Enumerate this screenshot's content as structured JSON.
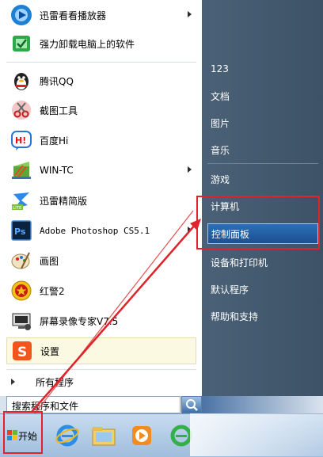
{
  "programs": [
    {
      "label": "迅雷看看播放器",
      "icon": "xunlei-kankan-icon",
      "submenu": true
    },
    {
      "label": "强力卸载电脑上的软件",
      "icon": "uninstall-icon",
      "submenu": false
    },
    {
      "label": "腾讯QQ",
      "icon": "qq-penguin-icon",
      "submenu": false
    },
    {
      "label": "截图工具",
      "icon": "snipping-tool-icon",
      "submenu": false
    },
    {
      "label": "百度Hi",
      "icon": "baidu-hi-icon",
      "submenu": false
    },
    {
      "label": "WIN-TC",
      "icon": "win-tc-icon",
      "submenu": true
    },
    {
      "label": "迅雷精简版",
      "icon": "xunlei-lite-icon",
      "submenu": false
    },
    {
      "label": "Adobe Photoshop CS5.1",
      "icon": "photoshop-icon",
      "submenu": true
    },
    {
      "label": "画图",
      "icon": "paint-icon",
      "submenu": false
    },
    {
      "label": "红警2",
      "icon": "red-alert-icon",
      "submenu": false
    },
    {
      "label": "屏幕录像专家V7.5",
      "icon": "screen-recorder-icon",
      "submenu": false
    },
    {
      "label": "设置",
      "icon": "sogou-settings-icon",
      "submenu": false
    }
  ],
  "all_programs": "所有程序",
  "search": {
    "placeholder": "搜索程序和文件"
  },
  "right_menu": [
    {
      "label": "123"
    },
    {
      "label": "文档"
    },
    {
      "label": "图片"
    },
    {
      "label": "音乐"
    },
    {
      "label": "游戏"
    },
    {
      "label": "计算机"
    },
    {
      "label": "控制面板"
    },
    {
      "label": "设备和打印机"
    },
    {
      "label": "默认程序"
    },
    {
      "label": "帮助和支持"
    }
  ],
  "taskbar": {
    "start_label": "开始",
    "apps": [
      "ie-icon",
      "explorer-icon",
      "media-player-icon",
      "ie-icon"
    ]
  },
  "colors": {
    "highlight": "#1d4f8f",
    "annotation": "#e0232a"
  }
}
